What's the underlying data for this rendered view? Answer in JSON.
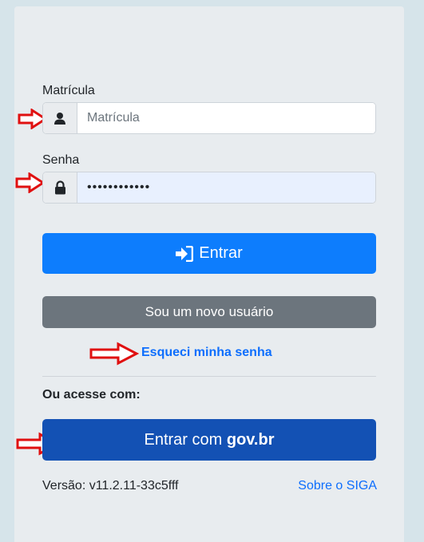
{
  "login": {
    "matricula_label": "Matrícula",
    "matricula_placeholder": "Matrícula",
    "senha_label": "Senha",
    "senha_value": "••••••••••••",
    "enter_button": "Entrar",
    "new_user_button": "Sou um novo usuário",
    "forgot_password": "Esqueci minha senha",
    "alt_access_label": "Ou acesse com:",
    "govbr_prefix": "Entrar com ",
    "govbr_brand": "gov.br",
    "version": "Versão: v11.2.11-33c5fff",
    "about_link": "Sobre o SIGA"
  },
  "icons": {
    "user": "user-icon",
    "lock": "lock-icon",
    "sign_in": "sign-in-icon",
    "arrow": "red-arrow-icon"
  },
  "colors": {
    "primary": "#0d7dfd",
    "secondary": "#6c757d",
    "govbr": "#1351b4",
    "link": "#0d6efd",
    "arrow": "#e01010"
  }
}
